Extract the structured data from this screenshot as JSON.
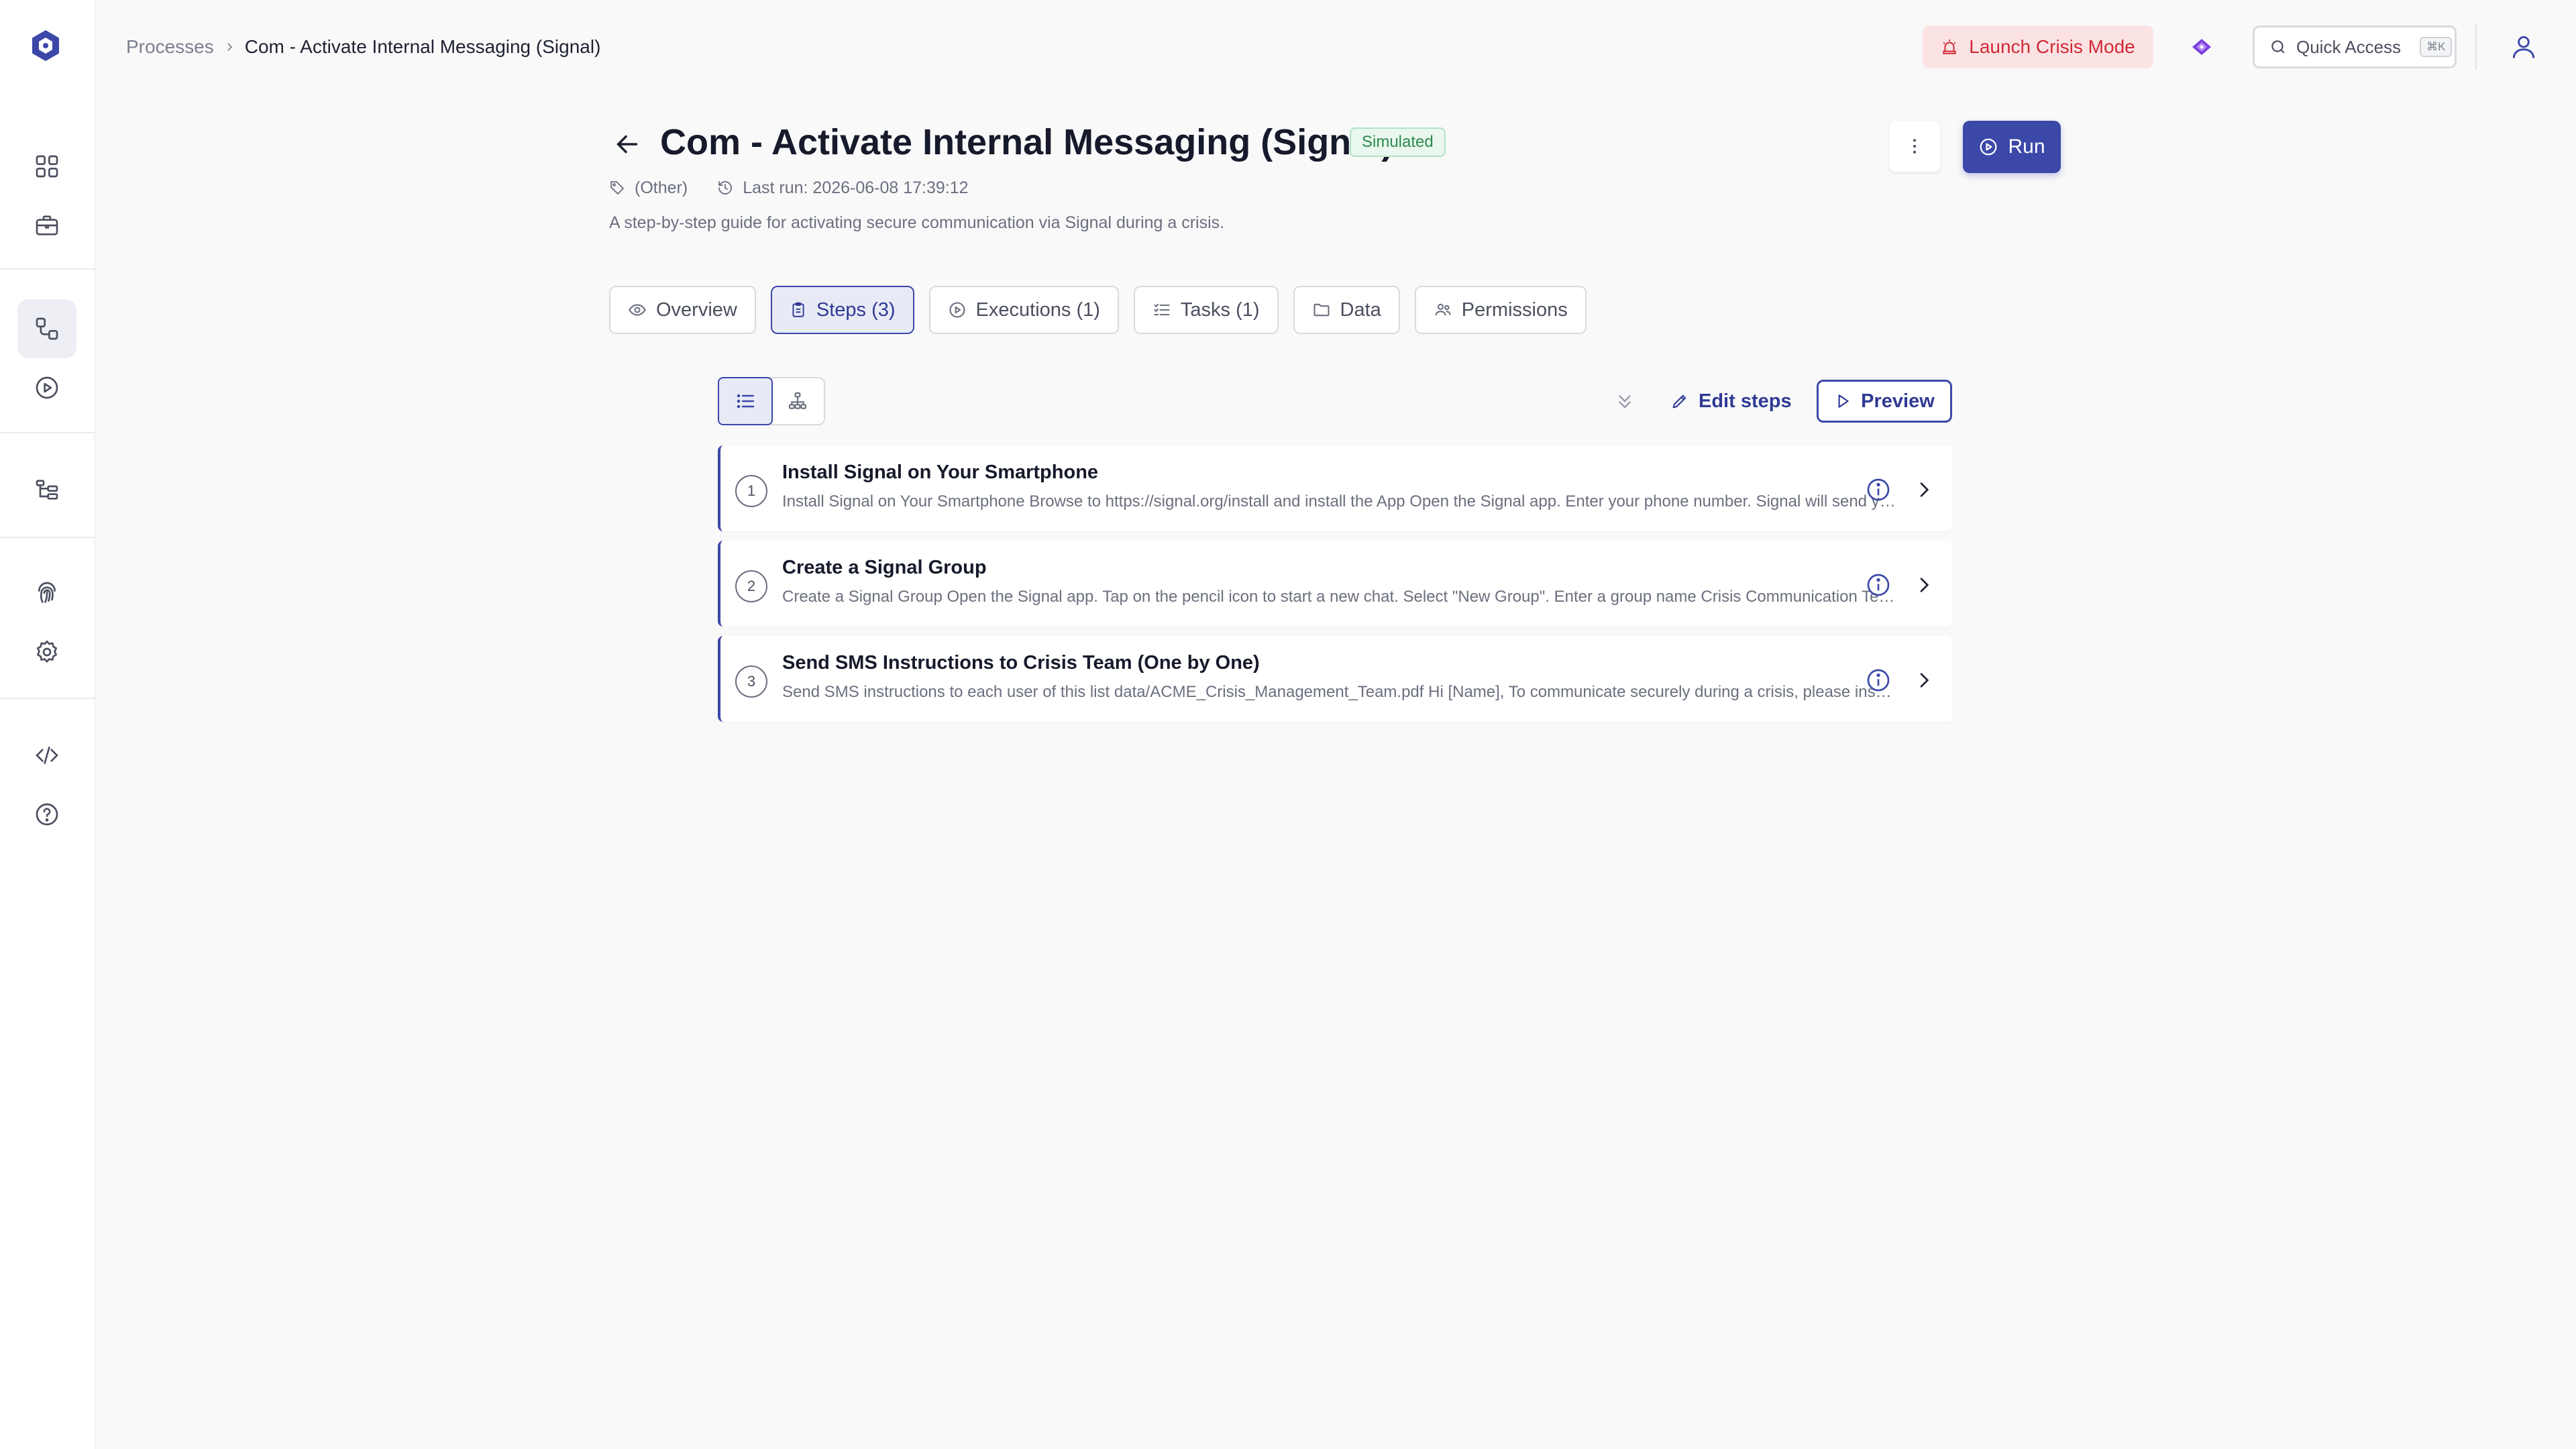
{
  "breadcrumb": {
    "parent": "Processes",
    "current": "Com - Activate Internal Messaging (Signal)"
  },
  "topbar": {
    "crisis_label": "Launch Crisis Mode",
    "quick_access_label": "Quick Access",
    "quick_access_shortcut": "⌘K"
  },
  "header": {
    "title": "Com - Activate Internal Messaging (Signal)",
    "badge": "Simulated",
    "tag": "(Other)",
    "last_run": "Last run: 2026-06-08 17:39:12",
    "description": "A step-by-step guide for activating secure communication via Signal during a crisis.",
    "run_label": "Run"
  },
  "tabs": [
    {
      "label": "Overview",
      "icon": "eye-icon"
    },
    {
      "label": "Steps (3)",
      "icon": "clipboard-icon",
      "active": true
    },
    {
      "label": "Executions (1)",
      "icon": "play-circle-icon"
    },
    {
      "label": "Tasks (1)",
      "icon": "checklist-icon"
    },
    {
      "label": "Data",
      "icon": "folder-icon"
    },
    {
      "label": "Permissions",
      "icon": "users-icon"
    }
  ],
  "toolbar": {
    "edit_label": "Edit steps",
    "preview_label": "Preview"
  },
  "steps": [
    {
      "num": "1",
      "title": "Install Signal on Your Smartphone",
      "desc": "Install Signal on Your Smartphone Browse to https://signal.org/install and install the App Open the Signal app. Enter your phone number. Signal will send you a verification code."
    },
    {
      "num": "2",
      "title": "Create a Signal Group",
      "desc": "Create a Signal Group Open the Signal app. Tap on the pencil icon to start a new chat. Select \"New Group\". Enter a group name Crisis Communication Team and add members."
    },
    {
      "num": "3",
      "title": "Send SMS Instructions to Crisis Team (One by One)",
      "desc": "Send SMS instructions to each user of this list data/ACME_Crisis_Management_Team.pdf Hi [Name], To communicate securely during a crisis, please install Signal."
    }
  ],
  "colors": {
    "accent": "#3c48a8",
    "crisis_bg": "#fbe3e4",
    "crisis_text": "#cf2a36",
    "badge_text": "#2c8a4f"
  }
}
